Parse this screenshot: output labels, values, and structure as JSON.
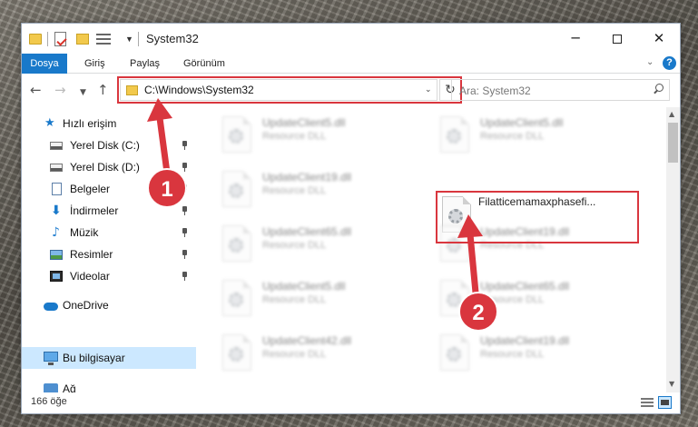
{
  "window": {
    "title": "System32",
    "controls": {
      "minimize": "─",
      "close": "✕"
    }
  },
  "ribbon": {
    "tabs": [
      "Dosya",
      "Giriş",
      "Paylaş",
      "Görünüm"
    ],
    "help": "?"
  },
  "navigation": {
    "address": "C:\\Windows\\System32",
    "search_placeholder": "Ara: System32"
  },
  "sidebar": {
    "items": [
      {
        "label": "Hızlı erişim",
        "icon": "quick-access-star-icon",
        "pinned": false
      },
      {
        "label": "Yerel Disk (C:)",
        "icon": "drive-icon",
        "pinned": true
      },
      {
        "label": "Yerel Disk (D:)",
        "icon": "drive-icon",
        "pinned": true
      },
      {
        "label": "Belgeler",
        "icon": "documents-icon",
        "pinned": true
      },
      {
        "label": "İndirmeler",
        "icon": "downloads-icon",
        "pinned": true
      },
      {
        "label": "Müzik",
        "icon": "music-icon",
        "pinned": true
      },
      {
        "label": "Resimler",
        "icon": "pictures-icon",
        "pinned": true
      },
      {
        "label": "Videolar",
        "icon": "videos-icon",
        "pinned": true
      },
      {
        "label": "OneDrive",
        "icon": "onedrive-cloud-icon",
        "pinned": false
      },
      {
        "label": "Bu bilgisayar",
        "icon": "this-pc-icon",
        "pinned": false,
        "selected": true
      },
      {
        "label": "Ağ",
        "icon": "network-icon",
        "pinned": false
      }
    ]
  },
  "files": [
    {
      "name": "UpdateClient5.dll",
      "type": "Resource DLL",
      "blurred": true
    },
    {
      "name": "UpdateClient5.dll",
      "type": "Resource DLL",
      "blurred": true
    },
    {
      "name": "UpdateClient19.dll",
      "type": "Resource DLL",
      "blurred": true
    },
    {
      "name": "Filatticemamaxphasefi...",
      "type": "",
      "blurred": false
    },
    {
      "name": "UpdateClient65.dll",
      "type": "Resource DLL",
      "blurred": true
    },
    {
      "name": "UpdateClient19.dll",
      "type": "Resource DLL",
      "blurred": true
    },
    {
      "name": "UpdateClient5.dll",
      "type": "Resource DLL",
      "blurred": true
    },
    {
      "name": "UpdateClient65.dll",
      "type": "Resource DLL",
      "blurred": true
    },
    {
      "name": "UpdateClient42.dll",
      "type": "Resource DLL",
      "blurred": true
    },
    {
      "name": "UpdateClient19.dll",
      "type": "Resource DLL",
      "blurred": true
    }
  ],
  "status": {
    "item_count": "166 öğe"
  },
  "annotations": {
    "step1": "1",
    "step2": "2",
    "color": "#d9363e"
  },
  "colors": {
    "accent": "#1979ca",
    "selection": "#cce8ff",
    "highlight": "#d9363e"
  }
}
